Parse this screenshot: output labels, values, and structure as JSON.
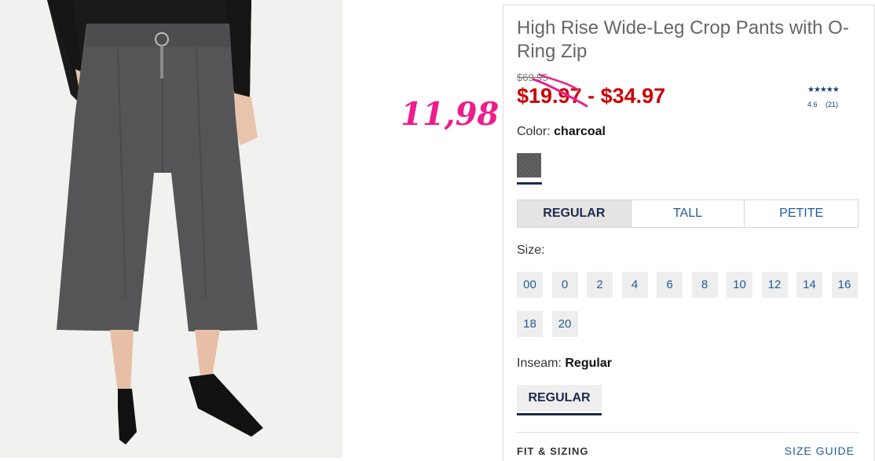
{
  "product": {
    "title": "High Rise Wide-Leg Crop Pants with O-Ring Zip",
    "original_price": "$69.95",
    "sale_price": "$19.97 - $34.97",
    "price_color": "#cc0000",
    "handwritten_note": "11,98",
    "handwritten_color": "#ee1c8c"
  },
  "rating": {
    "stars": "★★★★★",
    "value": "4.6",
    "count": "(21)"
  },
  "color": {
    "label": "Color:",
    "value": "charcoal",
    "swatch_hex": "#5c5c5c"
  },
  "fit_tabs": [
    {
      "label": "REGULAR",
      "active": true
    },
    {
      "label": "TALL",
      "active": false
    },
    {
      "label": "PETITE",
      "active": false
    }
  ],
  "size": {
    "label": "Size:",
    "options": [
      "00",
      "0",
      "2",
      "4",
      "6",
      "8",
      "10",
      "12",
      "14",
      "16",
      "18",
      "20"
    ]
  },
  "inseam": {
    "label": "Inseam:",
    "value": "Regular",
    "button_label": "REGULAR"
  },
  "footer": {
    "fit_sizing": "FIT & SIZING",
    "size_guide": "SIZE GUIDE"
  },
  "colors": {
    "accent_navy": "#1d2b4e",
    "link_blue": "#1f5c99"
  }
}
